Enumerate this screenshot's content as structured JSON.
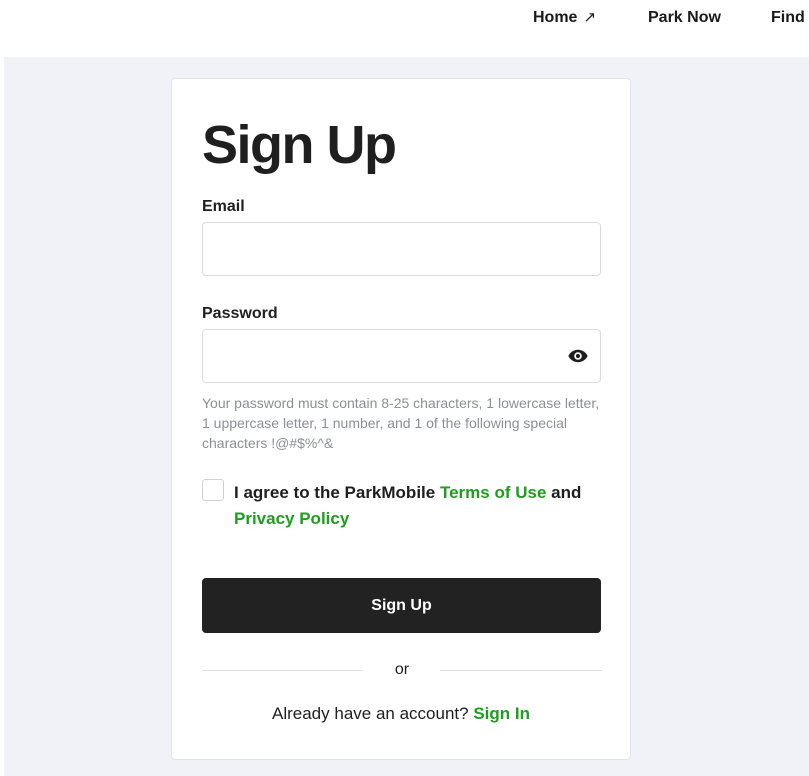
{
  "nav": {
    "home_label": "Home",
    "home_arrow": "↗",
    "park_now_label": "Park Now",
    "find_label": "Find"
  },
  "form": {
    "title": "Sign Up",
    "email_label": "Email",
    "email_value": "",
    "password_label": "Password",
    "password_value": "",
    "password_hint": "Your password must contain 8-25 characters, 1 lowercase letter, 1 uppercase letter, 1 number, and 1 of the following special characters !@#$%^&",
    "agree_prefix": "I agree to the ParkMobile ",
    "terms_link": "Terms of Use",
    "agree_and": " and",
    "privacy_link": "Privacy Policy",
    "agree_checked": false,
    "submit_label": "Sign Up",
    "divider_text": "or",
    "have_account_text": "Already have an account? ",
    "sign_in_link": "Sign In"
  },
  "icons": {
    "password_toggle": "eye-icon",
    "home_external": "arrow-up-right-icon"
  },
  "colors": {
    "page_background": "#f0f2f7",
    "link_green": "#1e9e1e",
    "button_dark": "#222222",
    "text_dark": "#1f1f1f",
    "hint_gray": "#8b8f96"
  }
}
